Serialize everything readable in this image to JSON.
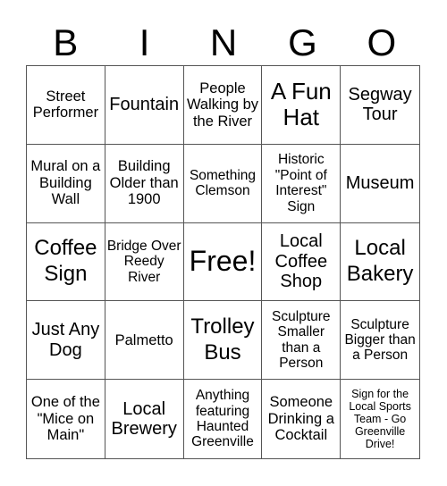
{
  "header": {
    "letters": [
      "B",
      "I",
      "N",
      "G",
      "O"
    ]
  },
  "cells": [
    "Street Performer",
    "Fountain",
    "People Walking by the River",
    "A Fun Hat",
    "Segway Tour",
    "Mural on a Building Wall",
    "Building Older than 1900",
    "Something Clemson",
    "Historic \"Point of Interest\" Sign",
    "Museum",
    "Coffee Sign",
    "Bridge Over Reedy River",
    "Free!",
    "Local Coffee Shop",
    "Local Bakery",
    "Just Any Dog",
    "Palmetto",
    "Trolley Bus",
    "Sculpture Smaller than a Person",
    "Sculpture Bigger than a Person",
    "One of the \"Mice on Main\"",
    "Local Brewery",
    "Anything featuring Haunted Greenville",
    "Someone Drinking a Cocktail",
    "Sign for the Local Sports Team - Go Greenville Drive!"
  ]
}
